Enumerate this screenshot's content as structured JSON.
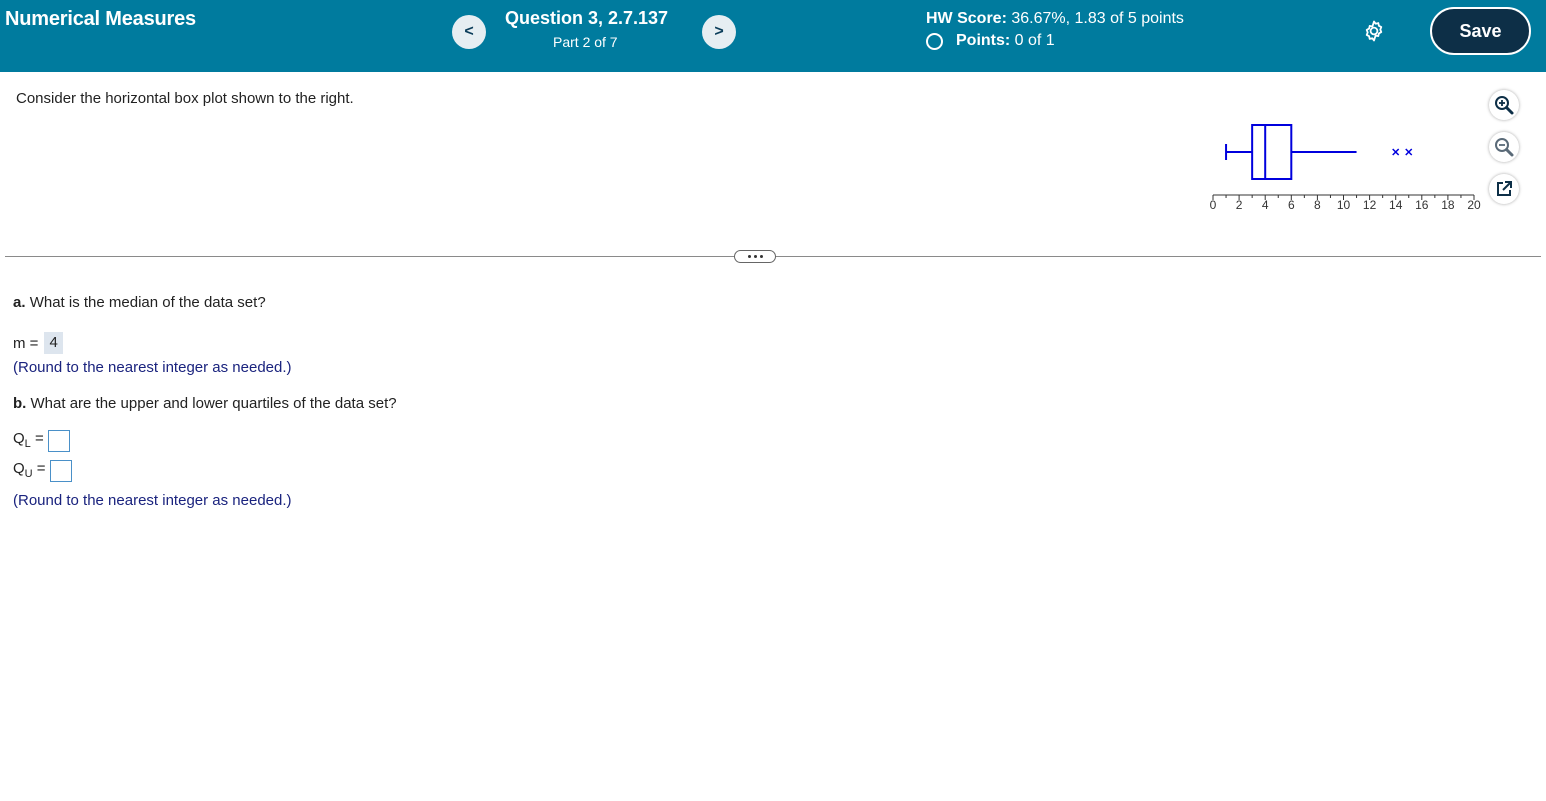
{
  "header": {
    "app_title": "Numerical Measures",
    "question_title": "Question 3, 2.7.137",
    "question_part": "Part 2 of 7",
    "hw_score_label": "HW Score:",
    "hw_score_value": "36.67%, 1.83 of 5 points",
    "points_label": "Points:",
    "points_value": "0 of 1",
    "prev_symbol": "<",
    "next_symbol": ">",
    "save_label": "Save"
  },
  "question": {
    "prompt": "Consider the horizontal box plot shown to the right.",
    "part_a_letter": "a.",
    "part_a_text": "What is the median of the data set?",
    "m_label": "m =",
    "m_value": "4",
    "round_hint_a": "(Round to the nearest integer as needed.)",
    "part_b_letter": "b.",
    "part_b_text": "What are the upper and lower quartiles of the data set?",
    "ql_label": "Q",
    "ql_sub": "L",
    "qu_label": "Q",
    "qu_sub": "U",
    "equals": "=",
    "round_hint_b": "(Round to the nearest integer as needed.)"
  },
  "colors": {
    "header_bg": "#007b9e",
    "save_bg": "#0d2f47",
    "plot_blue": "#0000dd",
    "hint_text": "#1a237e"
  },
  "icons": {
    "gear": "gear-icon",
    "zoom_in": "zoom-in-icon",
    "zoom_out": "zoom-out-icon",
    "popout": "popout-icon"
  },
  "chart_data": {
    "type": "boxplot",
    "whisker_low": 1,
    "q1": 3,
    "median": 4,
    "q3": 6,
    "whisker_high": 11,
    "outliers": [
      14,
      15
    ],
    "xlim": [
      0,
      20
    ],
    "tick_labels": [
      "0",
      "2",
      "4",
      "6",
      "8",
      "10",
      "12",
      "14",
      "16",
      "18",
      "20"
    ],
    "tick_values": [
      0,
      2,
      4,
      6,
      8,
      10,
      12,
      14,
      16,
      18,
      20
    ]
  }
}
